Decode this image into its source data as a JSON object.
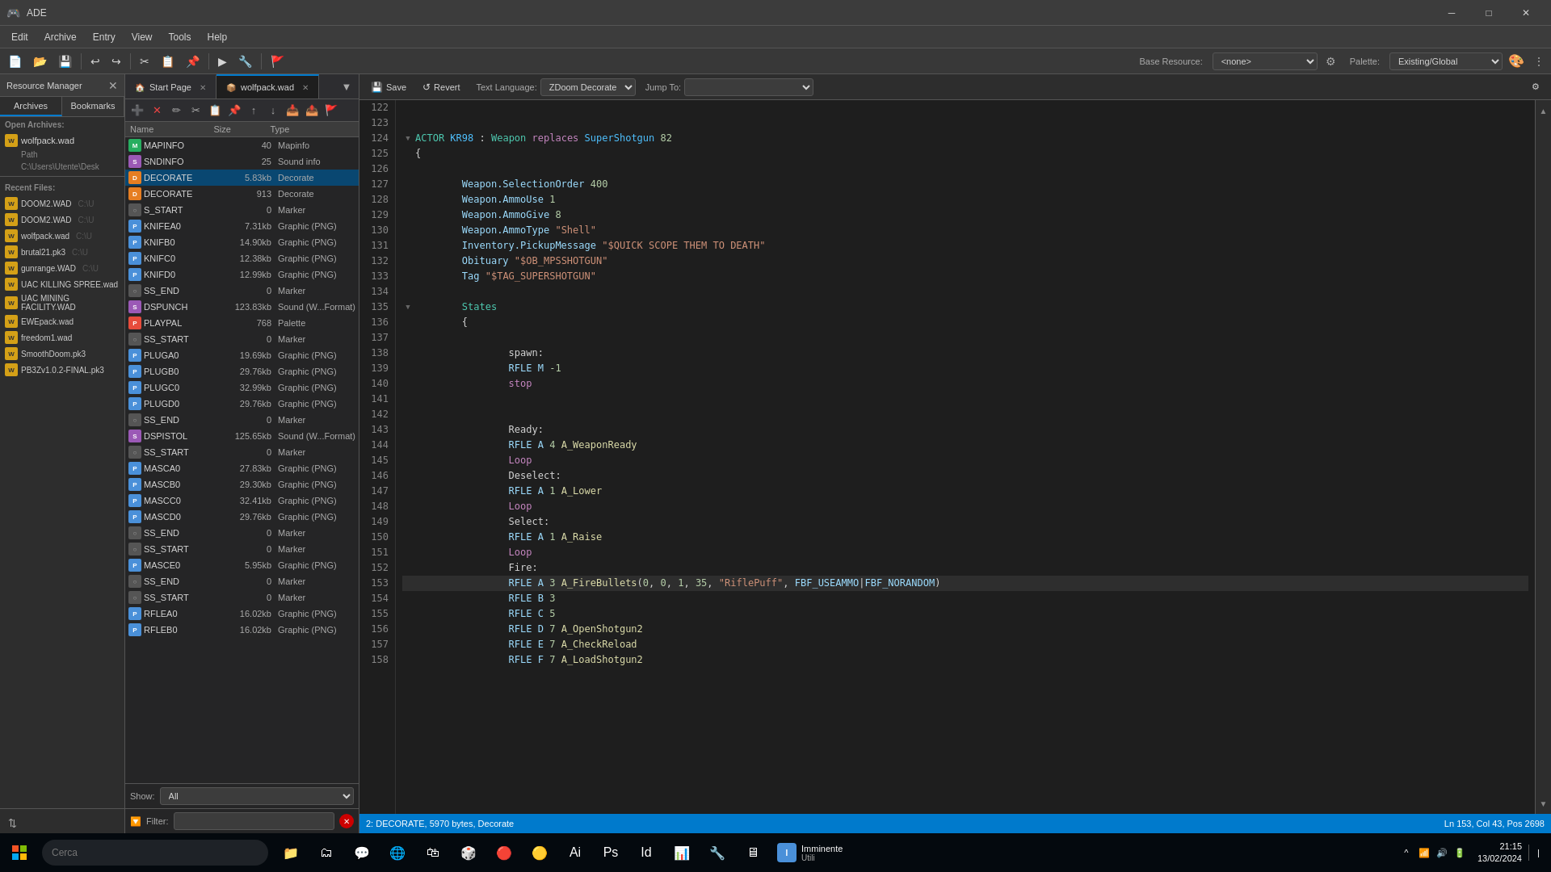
{
  "window": {
    "title": "ADE",
    "controls": {
      "minimize": "─",
      "maximize": "□",
      "close": "✕"
    }
  },
  "menu": {
    "items": [
      "Edit",
      "Archive",
      "Entry",
      "View",
      "Tools",
      "Help"
    ]
  },
  "top_toolbar": {
    "base_resource_label": "Base Resource:",
    "base_resource_value": "<none>",
    "palette_label": "Palette:",
    "palette_value": "Existing/Global"
  },
  "resource_manager": {
    "title": "Resource Manager",
    "tabs": [
      "Archives",
      "Bookmarks"
    ],
    "archive_header": "Open Archives:",
    "archive_item": "wolfpack.wad",
    "archive_path": "C:\\Users\\Utente\\Desk",
    "recent_header": "Recent Files:",
    "recent_items": [
      {
        "name": "DOOM2.WAD",
        "path": "C:\\U"
      },
      {
        "name": "DOOM2.WAD",
        "path": "C:\\U"
      },
      {
        "name": "wolfpack.wad",
        "path": "C:\\U"
      },
      {
        "name": "brutal21.pk3",
        "path": "C:\\U"
      },
      {
        "name": "gunrange.WAD",
        "path": "C:\\U"
      },
      {
        "name": "UAC KILLING SPREE.wad",
        "path": "C:\\U"
      },
      {
        "name": "UAC MINING FACILITY.WAD",
        "path": "C:\\U"
      },
      {
        "name": "EWEpack.wad",
        "path": "C:\\U"
      },
      {
        "name": "freedom1.wad",
        "path": "C:\\U"
      },
      {
        "name": "SmoothDoom.pk3",
        "path": "C:\\U"
      },
      {
        "name": "PB3Zv1.0.2-FINAL.pk3",
        "path": "C:\\U"
      }
    ]
  },
  "file_browser": {
    "tabs": [
      {
        "icon": "🏠",
        "name": "Start Page",
        "active": false
      },
      {
        "icon": "📦",
        "name": "wolfpack.wad",
        "active": true
      }
    ],
    "columns": {
      "name": "Name",
      "size": "Size",
      "type": "Type"
    },
    "files": [
      {
        "name": "MAPINFO",
        "size": "40",
        "type": "Mapinfo",
        "icon": "map"
      },
      {
        "name": "SNDINFO",
        "size": "25",
        "type": "Sound info",
        "icon": "snd"
      },
      {
        "name": "DECORATE",
        "size": "5.83kb",
        "type": "Decorate",
        "icon": "dec",
        "selected": true
      },
      {
        "name": "DECORATE",
        "size": "913",
        "type": "Decorate",
        "icon": "dec"
      },
      {
        "name": "S_START",
        "size": "0",
        "type": "Marker",
        "icon": "mrk"
      },
      {
        "name": "KNIFEA0",
        "size": "7.31kb",
        "type": "Graphic (PNG)",
        "icon": "png"
      },
      {
        "name": "KNIFB0",
        "size": "14.90kb",
        "type": "Graphic (PNG)",
        "icon": "png"
      },
      {
        "name": "KNIFC0",
        "size": "12.38kb",
        "type": "Graphic (PNG)",
        "icon": "png"
      },
      {
        "name": "KNIFD0",
        "size": "12.99kb",
        "type": "Graphic (PNG)",
        "icon": "png"
      },
      {
        "name": "SS_END",
        "size": "0",
        "type": "Marker",
        "icon": "mrk"
      },
      {
        "name": "DSPUNCH",
        "size": "123.83kb",
        "type": "Sound (W...Format)",
        "icon": "snd"
      },
      {
        "name": "PLAYPAL",
        "size": "768",
        "type": "Palette",
        "icon": "pal"
      },
      {
        "name": "SS_START",
        "size": "0",
        "type": "Marker",
        "icon": "mrk"
      },
      {
        "name": "PLUGA0",
        "size": "19.69kb",
        "type": "Graphic (PNG)",
        "icon": "png"
      },
      {
        "name": "PLUGB0",
        "size": "29.76kb",
        "type": "Graphic (PNG)",
        "icon": "png"
      },
      {
        "name": "PLUGC0",
        "size": "32.99kb",
        "type": "Graphic (PNG)",
        "icon": "png"
      },
      {
        "name": "PLUGD0",
        "size": "29.76kb",
        "type": "Graphic (PNG)",
        "icon": "png"
      },
      {
        "name": "SS_END",
        "size": "0",
        "type": "Marker",
        "icon": "mrk"
      },
      {
        "name": "DSPISTOL",
        "size": "125.65kb",
        "type": "Sound (W...Format)",
        "icon": "snd"
      },
      {
        "name": "SS_START",
        "size": "0",
        "type": "Marker",
        "icon": "mrk"
      },
      {
        "name": "MASCA0",
        "size": "27.83kb",
        "type": "Graphic (PNG)",
        "icon": "png"
      },
      {
        "name": "MASCB0",
        "size": "29.30kb",
        "type": "Graphic (PNG)",
        "icon": "png"
      },
      {
        "name": "MASCC0",
        "size": "32.41kb",
        "type": "Graphic (PNG)",
        "icon": "png"
      },
      {
        "name": "MASCD0",
        "size": "29.76kb",
        "type": "Graphic (PNG)",
        "icon": "png"
      },
      {
        "name": "SS_END",
        "size": "0",
        "type": "Marker",
        "icon": "mrk"
      },
      {
        "name": "SS_START",
        "size": "0",
        "type": "Marker",
        "icon": "mrk"
      },
      {
        "name": "MASCE0",
        "size": "5.95kb",
        "type": "Graphic (PNG)",
        "icon": "png"
      },
      {
        "name": "SS_END",
        "size": "0",
        "type": "Marker",
        "icon": "mrk"
      },
      {
        "name": "SS_START",
        "size": "0",
        "type": "Marker",
        "icon": "mrk"
      },
      {
        "name": "RFLEA0",
        "size": "16.02kb",
        "type": "Graphic (PNG)",
        "icon": "png"
      },
      {
        "name": "RFLEB0",
        "size": "16.02kb",
        "type": "Graphic (PNG)",
        "icon": "png"
      }
    ],
    "show_label": "Show:",
    "show_value": "All",
    "filter_label": "Filter:",
    "filter_placeholder": ""
  },
  "editor": {
    "save_label": "Save",
    "revert_label": "Revert",
    "text_language_label": "Text Language:",
    "language_value": "ZDoom Decorate",
    "jump_to_label": "Jump To:",
    "lines": [
      {
        "num": 122,
        "text": "",
        "indent": 0
      },
      {
        "num": 123,
        "text": "",
        "indent": 0
      },
      {
        "num": 124,
        "text": "ACTOR KR98 : Weapon replaces SuperShotgun 82",
        "fold": true,
        "type": "actor_decl"
      },
      {
        "num": 125,
        "text": "{",
        "indent": 0
      },
      {
        "num": 126,
        "text": "",
        "indent": 0
      },
      {
        "num": 127,
        "text": "    Weapon.SelectionOrder 400",
        "indent": 1,
        "type": "prop"
      },
      {
        "num": 128,
        "text": "    Weapon.AmmoUse 1",
        "indent": 1,
        "type": "prop"
      },
      {
        "num": 129,
        "text": "    Weapon.AmmoGive 8",
        "indent": 1,
        "type": "prop"
      },
      {
        "num": 130,
        "text": "    Weapon.AmmoType \"Shell\"",
        "indent": 1,
        "type": "prop"
      },
      {
        "num": 131,
        "text": "    Inventory.PickupMessage \"$QUICK SCOPE THEM TO DEATH\"",
        "indent": 1,
        "type": "prop"
      },
      {
        "num": 132,
        "text": "    Obituary \"$OB_MPSSHOTGUN\"",
        "indent": 1,
        "type": "prop"
      },
      {
        "num": 133,
        "text": "    Tag \"$TAG_SUPERSHOTGUN\"",
        "indent": 1,
        "type": "prop"
      },
      {
        "num": 134,
        "text": "",
        "indent": 0
      },
      {
        "num": 135,
        "text": "    States",
        "indent": 1,
        "fold": true,
        "type": "states"
      },
      {
        "num": 136,
        "text": "    {",
        "indent": 1
      },
      {
        "num": 137,
        "text": "",
        "indent": 0
      },
      {
        "num": 138,
        "text": "        spawn:",
        "indent": 2,
        "type": "label"
      },
      {
        "num": 139,
        "text": "        RFLE M -1",
        "indent": 2,
        "type": "sprite"
      },
      {
        "num": 140,
        "text": "        stop",
        "indent": 2,
        "type": "kw"
      },
      {
        "num": 141,
        "text": "",
        "indent": 0
      },
      {
        "num": 142,
        "text": "",
        "indent": 0
      },
      {
        "num": 143,
        "text": "        Ready:",
        "indent": 2,
        "type": "label"
      },
      {
        "num": 144,
        "text": "        RFLE A 4 A_WeaponReady",
        "indent": 2,
        "type": "sprite"
      },
      {
        "num": 145,
        "text": "        Loop",
        "indent": 2,
        "type": "kw"
      },
      {
        "num": 146,
        "text": "        Deselect:",
        "indent": 2,
        "type": "label"
      },
      {
        "num": 147,
        "text": "        RFLE A 1 A_Lower",
        "indent": 2,
        "type": "sprite"
      },
      {
        "num": 148,
        "text": "        Loop",
        "indent": 2,
        "type": "kw"
      },
      {
        "num": 149,
        "text": "        Select:",
        "indent": 2,
        "type": "label"
      },
      {
        "num": 150,
        "text": "        RFLE A 1 A_Raise",
        "indent": 2,
        "type": "sprite"
      },
      {
        "num": 151,
        "text": "        Loop",
        "indent": 2,
        "type": "kw"
      },
      {
        "num": 152,
        "text": "        Fire:",
        "indent": 2,
        "type": "label"
      },
      {
        "num": 153,
        "text": "        RFLE A 3 A_FireBullets(0, 0, 1, 35, \"RiflePuff\", FBF_USEAMMO|FBF_NORANDOM)",
        "indent": 2,
        "type": "sprite",
        "current": true
      },
      {
        "num": 154,
        "text": "        RFLE B 3",
        "indent": 2,
        "type": "sprite"
      },
      {
        "num": 155,
        "text": "        RFLE C 5",
        "indent": 2,
        "type": "sprite"
      },
      {
        "num": 156,
        "text": "        RFLE D 7 A_OpenShotgun2",
        "indent": 2,
        "type": "sprite"
      },
      {
        "num": 157,
        "text": "        RFLE E 7 A_CheckReload",
        "indent": 2,
        "type": "sprite"
      },
      {
        "num": 158,
        "text": "        RFLE F 7 A_LoadShotgun2",
        "indent": 2,
        "type": "sprite"
      }
    ],
    "status_bar": {
      "file_info": "2: DECORATE, 5970 bytes, Decorate",
      "position": "Ln 153, Col 43, Pos 2698"
    }
  },
  "taskbar": {
    "search_placeholder": "Cerca",
    "app_name": "Imminente",
    "app_subtitle": "Utili",
    "time": "21:15",
    "date": "13/02/2024"
  }
}
